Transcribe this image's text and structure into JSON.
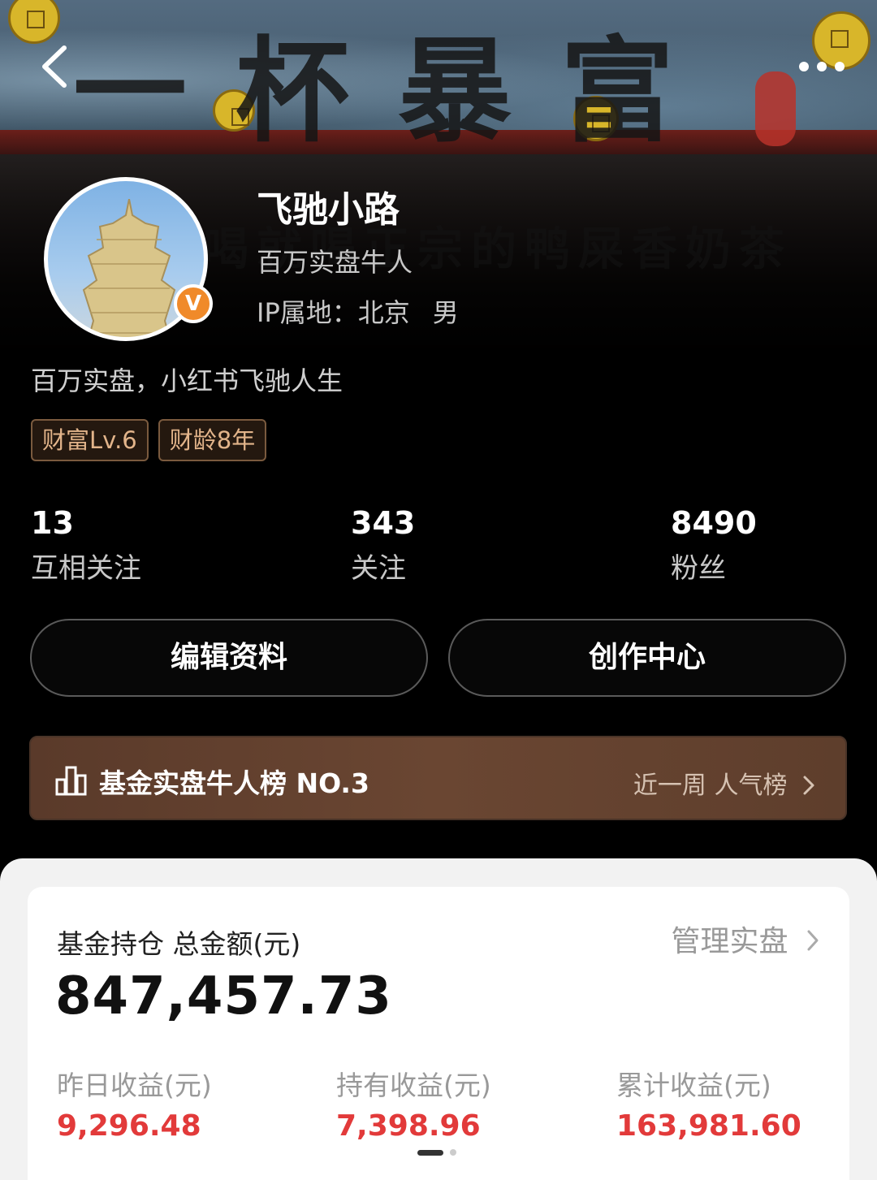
{
  "banner": {
    "title": "一杯暴富",
    "subtitle": "喝就喝正宗的鸭屎香奶茶"
  },
  "profile": {
    "name": "飞驰小路",
    "title": "百万实盘牛人",
    "ip_label": "IP属地：北京",
    "gender": "男",
    "bio": "百万实盘，小红书飞驰人生",
    "verified_badge": "V",
    "tags": [
      "财富Lv.6",
      "财龄8年"
    ]
  },
  "stats": [
    {
      "value": "13",
      "label": "互相关注"
    },
    {
      "value": "343",
      "label": "关注"
    },
    {
      "value": "8490",
      "label": "粉丝"
    }
  ],
  "buttons": {
    "edit_profile": "编辑资料",
    "creator_center": "创作中心"
  },
  "ranking": {
    "text": "基金实盘牛人榜 NO.3",
    "link": "近一周 人气榜"
  },
  "holdings": {
    "title": "基金持仓 总金额(元)",
    "manage_label": "管理实盘",
    "total": "847,457.73",
    "earnings": [
      {
        "label": "昨日收益(元)",
        "value": "9,296.48"
      },
      {
        "label": "持有收益(元)",
        "value": "7,398.96"
      },
      {
        "label": "累计收益(元)",
        "value": "163,981.60"
      }
    ]
  },
  "colors": {
    "accent_red": "#e23a3a",
    "tag_gold": "#e2b48a",
    "verified_orange": "#f08a2a",
    "rank_brown": "#6a4632"
  },
  "icons": {
    "back": "chevron-left-icon",
    "more": "more-dots-icon",
    "ranking": "bar-chart-icon",
    "link_arrow": "chevron-right-icon"
  }
}
